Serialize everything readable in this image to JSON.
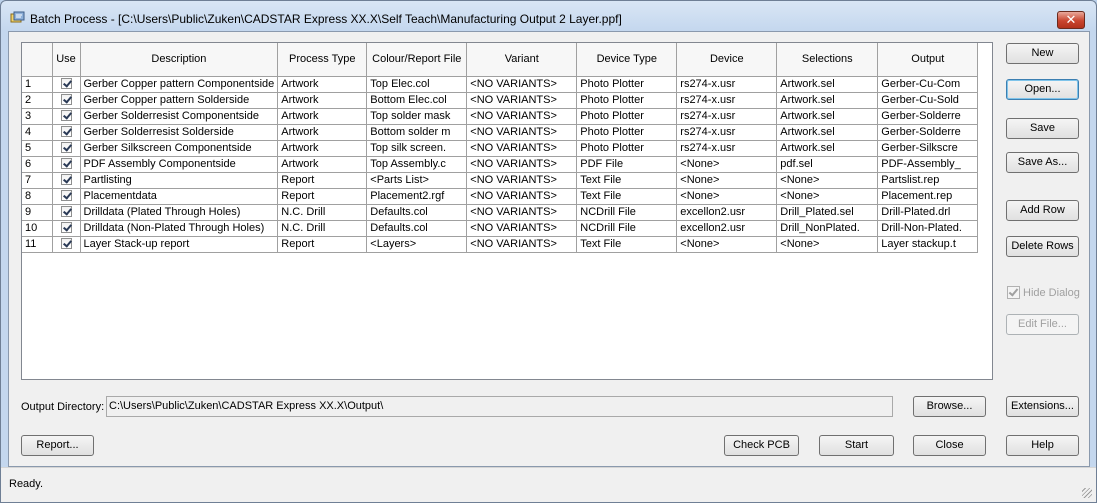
{
  "window": {
    "title": "Batch Process - [C:\\Users\\Public\\Zuken\\CADSTAR Express XX.X\\Self Teach\\Manufacturing Output 2 Layer.ppf]",
    "close_glyph": "✕"
  },
  "grid": {
    "columns": [
      "",
      "Use",
      "Description",
      "Process Type",
      "Colour/Report File",
      "Variant",
      "Device Type",
      "Device",
      "Selections",
      "Output"
    ],
    "rows": [
      [
        "1",
        "Gerber Copper pattern Componentside",
        "Artwork",
        "Top Elec.col",
        "<NO VARIANTS>",
        "Photo Plotter",
        "rs274-x.usr",
        "Artwork.sel",
        "Gerber-Cu-Com"
      ],
      [
        "2",
        "Gerber Copper pattern Solderside",
        "Artwork",
        "Bottom Elec.col",
        "<NO VARIANTS>",
        "Photo Plotter",
        "rs274-x.usr",
        "Artwork.sel",
        "Gerber-Cu-Sold"
      ],
      [
        "3",
        "Gerber Solderresist Componentside",
        "Artwork",
        "Top solder mask",
        "<NO VARIANTS>",
        "Photo Plotter",
        "rs274-x.usr",
        "Artwork.sel",
        "Gerber-Solderre"
      ],
      [
        "4",
        "Gerber Solderresist Solderside",
        "Artwork",
        "Bottom solder m",
        "<NO VARIANTS>",
        "Photo Plotter",
        "rs274-x.usr",
        "Artwork.sel",
        "Gerber-Solderre"
      ],
      [
        "5",
        "Gerber Silkscreen Componentside",
        "Artwork",
        "Top silk screen.",
        "<NO VARIANTS>",
        "Photo Plotter",
        "rs274-x.usr",
        "Artwork.sel",
        "Gerber-Silkscre"
      ],
      [
        "6",
        "PDF Assembly Componentside",
        "Artwork",
        "Top Assembly.c",
        "<NO VARIANTS>",
        "PDF File",
        "<None>",
        "pdf.sel",
        "PDF-Assembly_"
      ],
      [
        "7",
        "Partlisting",
        "Report",
        "<Parts List>",
        "<NO VARIANTS>",
        "Text File",
        "<None>",
        "<None>",
        "Partslist.rep"
      ],
      [
        "8",
        "Placementdata",
        "Report",
        "Placement2.rgf",
        "<NO VARIANTS>",
        "Text File",
        "<None>",
        "<None>",
        "Placement.rep"
      ],
      [
        "9",
        "Drilldata (Plated Through Holes)",
        "N.C. Drill",
        "Defaults.col",
        "<NO VARIANTS>",
        "NCDrill File",
        "excellon2.usr",
        "Drill_Plated.sel",
        "Drill-Plated.drl"
      ],
      [
        "10",
        "Drilldata (Non-Plated Through Holes)",
        "N.C. Drill",
        "Defaults.col",
        "<NO VARIANTS>",
        "NCDrill File",
        "excellon2.usr",
        "Drill_NonPlated.",
        "Drill-Non-Plated."
      ],
      [
        "11",
        "Layer Stack-up report",
        "Report",
        "<Layers>",
        "<NO VARIANTS>",
        "Text File",
        "<None>",
        "<None>",
        "Layer stackup.t"
      ]
    ]
  },
  "buttons": {
    "new": "New",
    "open": "Open...",
    "save": "Save",
    "save_as": "Save As...",
    "add_row": "Add Row",
    "delete_rows": "Delete Rows",
    "hide_dialog": "Hide Dialog",
    "edit_file": "Edit File...",
    "browse": "Browse...",
    "extensions": "Extensions...",
    "report": "Report...",
    "check_pcb": "Check PCB",
    "start": "Start",
    "close": "Close",
    "help": "Help"
  },
  "output_directory": {
    "label": "Output Directory:",
    "value": "C:\\Users\\Public\\Zuken\\CADSTAR Express XX.X\\Output\\"
  },
  "status": {
    "text": "Ready."
  }
}
